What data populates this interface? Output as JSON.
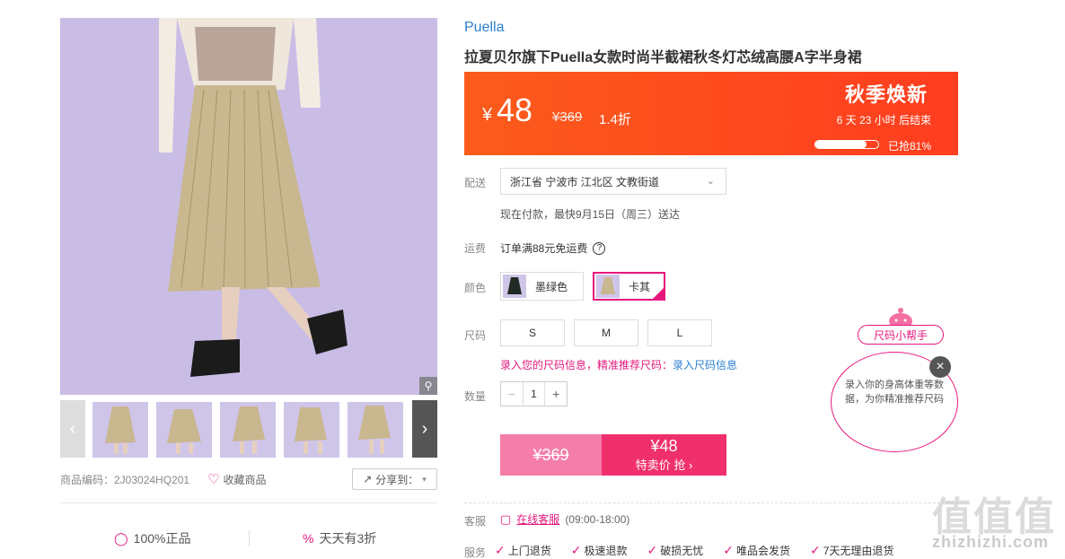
{
  "gallery": {
    "product_code_label": "商品编码：2J03024HQ201",
    "favorite_label": "收藏商品",
    "share_label": "分享到：",
    "thumbs_count": 5
  },
  "promises": [
    {
      "label": "100%正品",
      "icon": "shield-icon"
    },
    {
      "label": "天天有3折",
      "icon": "percent-icon"
    }
  ],
  "product": {
    "brand": "Puella",
    "title": "拉夏贝尔旗下Puella女款时尚半截裙秋冬灯芯绒高腰A字半身裙"
  },
  "price_bar": {
    "currency": "¥",
    "price": "48",
    "original": "¥369",
    "discount": "1.4折",
    "event_title": "秋季焕新",
    "countdown": "6 天 23 小时 后结束",
    "sold_label": "已抢81%",
    "sold_fraction": 0.81,
    "bg_color": "#ff4a1d"
  },
  "delivery": {
    "label": "配送",
    "address": "浙江省 宁波市 江北区 文教街道",
    "note": "现在付款，最快9月15日（周三）送达"
  },
  "freight": {
    "label": "运费",
    "text": "订单满88元免运费",
    "help_icon": "?"
  },
  "color": {
    "label": "颜色",
    "options": [
      {
        "name": "墨绿色",
        "selected": false
      },
      {
        "name": "卡其",
        "selected": true
      }
    ]
  },
  "size": {
    "label": "尺码",
    "options": [
      "S",
      "M",
      "L"
    ],
    "tip_prefix": "录入您的尺码信息，精准推荐尺码：",
    "tip_link": "录入尺码信息"
  },
  "quantity": {
    "label": "数量",
    "minus": "−",
    "value": "1",
    "plus": "+"
  },
  "buy": {
    "original_price": "¥369",
    "deal_price": "¥48",
    "deal_label": "特卖价 抢 ›"
  },
  "service": {
    "label": "客服",
    "link": "在线客服",
    "hours": "(09:00-18:00)"
  },
  "guarantees": {
    "label": "服务",
    "items": [
      "上门退货",
      "极速退款",
      "破损无忧",
      "唯品会发货",
      "7天无理由退货"
    ]
  },
  "size_helper": {
    "tag": "尺码小帮手",
    "bubble_text": "录入你的身高体重等数据，为你精准推荐尺码",
    "close": "×"
  },
  "watermark": {
    "main": "值值值",
    "sub": "zhizhizhi.com"
  },
  "colors": {
    "accent": "#e6177d",
    "link": "#2b7fd1",
    "price_orange": "#ff4a1d"
  }
}
